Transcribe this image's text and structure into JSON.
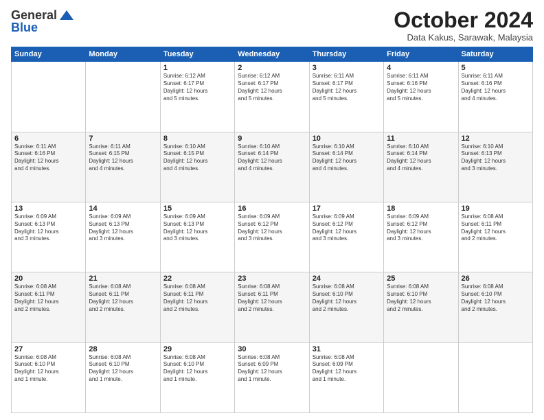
{
  "logo": {
    "line1": "General",
    "line2": "Blue"
  },
  "title": "October 2024",
  "subtitle": "Data Kakus, Sarawak, Malaysia",
  "days_header": [
    "Sunday",
    "Monday",
    "Tuesday",
    "Wednesday",
    "Thursday",
    "Friday",
    "Saturday"
  ],
  "weeks": [
    [
      {
        "day": "",
        "info": ""
      },
      {
        "day": "",
        "info": ""
      },
      {
        "day": "1",
        "info": "Sunrise: 6:12 AM\nSunset: 6:17 PM\nDaylight: 12 hours\nand 5 minutes."
      },
      {
        "day": "2",
        "info": "Sunrise: 6:12 AM\nSunset: 6:17 PM\nDaylight: 12 hours\nand 5 minutes."
      },
      {
        "day": "3",
        "info": "Sunrise: 6:11 AM\nSunset: 6:17 PM\nDaylight: 12 hours\nand 5 minutes."
      },
      {
        "day": "4",
        "info": "Sunrise: 6:11 AM\nSunset: 6:16 PM\nDaylight: 12 hours\nand 5 minutes."
      },
      {
        "day": "5",
        "info": "Sunrise: 6:11 AM\nSunset: 6:16 PM\nDaylight: 12 hours\nand 4 minutes."
      }
    ],
    [
      {
        "day": "6",
        "info": "Sunrise: 6:11 AM\nSunset: 6:16 PM\nDaylight: 12 hours\nand 4 minutes."
      },
      {
        "day": "7",
        "info": "Sunrise: 6:11 AM\nSunset: 6:15 PM\nDaylight: 12 hours\nand 4 minutes."
      },
      {
        "day": "8",
        "info": "Sunrise: 6:10 AM\nSunset: 6:15 PM\nDaylight: 12 hours\nand 4 minutes."
      },
      {
        "day": "9",
        "info": "Sunrise: 6:10 AM\nSunset: 6:14 PM\nDaylight: 12 hours\nand 4 minutes."
      },
      {
        "day": "10",
        "info": "Sunrise: 6:10 AM\nSunset: 6:14 PM\nDaylight: 12 hours\nand 4 minutes."
      },
      {
        "day": "11",
        "info": "Sunrise: 6:10 AM\nSunset: 6:14 PM\nDaylight: 12 hours\nand 4 minutes."
      },
      {
        "day": "12",
        "info": "Sunrise: 6:10 AM\nSunset: 6:13 PM\nDaylight: 12 hours\nand 3 minutes."
      }
    ],
    [
      {
        "day": "13",
        "info": "Sunrise: 6:09 AM\nSunset: 6:13 PM\nDaylight: 12 hours\nand 3 minutes."
      },
      {
        "day": "14",
        "info": "Sunrise: 6:09 AM\nSunset: 6:13 PM\nDaylight: 12 hours\nand 3 minutes."
      },
      {
        "day": "15",
        "info": "Sunrise: 6:09 AM\nSunset: 6:13 PM\nDaylight: 12 hours\nand 3 minutes."
      },
      {
        "day": "16",
        "info": "Sunrise: 6:09 AM\nSunset: 6:12 PM\nDaylight: 12 hours\nand 3 minutes."
      },
      {
        "day": "17",
        "info": "Sunrise: 6:09 AM\nSunset: 6:12 PM\nDaylight: 12 hours\nand 3 minutes."
      },
      {
        "day": "18",
        "info": "Sunrise: 6:09 AM\nSunset: 6:12 PM\nDaylight: 12 hours\nand 3 minutes."
      },
      {
        "day": "19",
        "info": "Sunrise: 6:08 AM\nSunset: 6:11 PM\nDaylight: 12 hours\nand 2 minutes."
      }
    ],
    [
      {
        "day": "20",
        "info": "Sunrise: 6:08 AM\nSunset: 6:11 PM\nDaylight: 12 hours\nand 2 minutes."
      },
      {
        "day": "21",
        "info": "Sunrise: 6:08 AM\nSunset: 6:11 PM\nDaylight: 12 hours\nand 2 minutes."
      },
      {
        "day": "22",
        "info": "Sunrise: 6:08 AM\nSunset: 6:11 PM\nDaylight: 12 hours\nand 2 minutes."
      },
      {
        "day": "23",
        "info": "Sunrise: 6:08 AM\nSunset: 6:11 PM\nDaylight: 12 hours\nand 2 minutes."
      },
      {
        "day": "24",
        "info": "Sunrise: 6:08 AM\nSunset: 6:10 PM\nDaylight: 12 hours\nand 2 minutes."
      },
      {
        "day": "25",
        "info": "Sunrise: 6:08 AM\nSunset: 6:10 PM\nDaylight: 12 hours\nand 2 minutes."
      },
      {
        "day": "26",
        "info": "Sunrise: 6:08 AM\nSunset: 6:10 PM\nDaylight: 12 hours\nand 2 minutes."
      }
    ],
    [
      {
        "day": "27",
        "info": "Sunrise: 6:08 AM\nSunset: 6:10 PM\nDaylight: 12 hours\nand 1 minute."
      },
      {
        "day": "28",
        "info": "Sunrise: 6:08 AM\nSunset: 6:10 PM\nDaylight: 12 hours\nand 1 minute."
      },
      {
        "day": "29",
        "info": "Sunrise: 6:08 AM\nSunset: 6:10 PM\nDaylight: 12 hours\nand 1 minute."
      },
      {
        "day": "30",
        "info": "Sunrise: 6:08 AM\nSunset: 6:09 PM\nDaylight: 12 hours\nand 1 minute."
      },
      {
        "day": "31",
        "info": "Sunrise: 6:08 AM\nSunset: 6:09 PM\nDaylight: 12 hours\nand 1 minute."
      },
      {
        "day": "",
        "info": ""
      },
      {
        "day": "",
        "info": ""
      }
    ]
  ]
}
